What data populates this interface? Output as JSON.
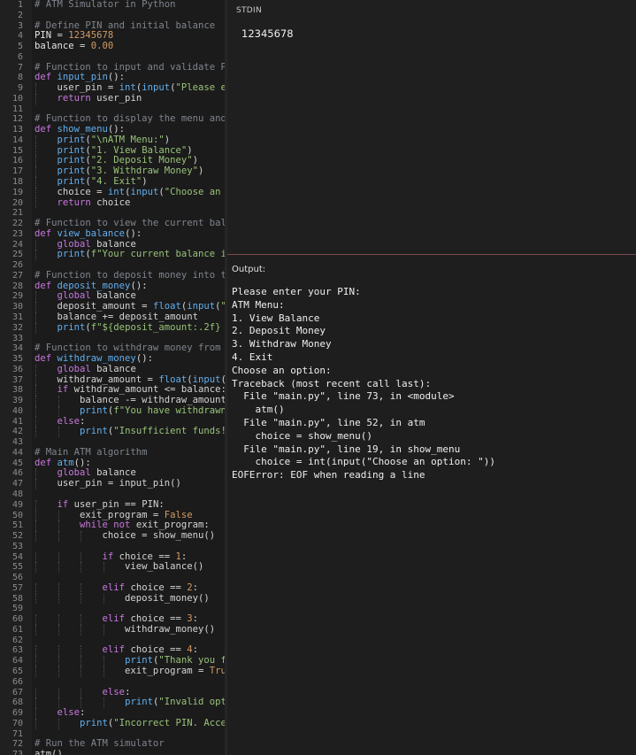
{
  "stdin": {
    "label": "STDIN",
    "value": "12345678"
  },
  "output": {
    "label": "Output:",
    "lines": [
      "Please enter your PIN:",
      "ATM Menu:",
      "1. View Balance",
      "2. Deposit Money",
      "3. Withdraw Money",
      "4. Exit",
      "Choose an option:",
      "Traceback (most recent call last):",
      "  File \"main.py\", line 73, in <module>",
      "    atm()",
      "  File \"main.py\", line 52, in atm",
      "    choice = show_menu()",
      "  File \"main.py\", line 19, in show_menu",
      "    choice = int(input(\"Choose an option: \"))",
      "EOFError: EOF when reading a line"
    ]
  },
  "editor": {
    "lines": [
      [
        [
          "c",
          "# ATM Simulator in Python"
        ]
      ],
      [],
      [
        [
          "c",
          "# Define PIN and initial balance"
        ]
      ],
      [
        [
          "v",
          "PIN "
        ],
        [
          "o",
          "= "
        ],
        [
          "n",
          "12345678"
        ]
      ],
      [
        [
          "v",
          "balance "
        ],
        [
          "o",
          "= "
        ],
        [
          "n",
          "0.00"
        ]
      ],
      [],
      [
        [
          "c",
          "# Function to input and validate PI"
        ]
      ],
      [
        [
          "k",
          "def "
        ],
        [
          "f",
          "input_pin"
        ],
        [
          "o",
          "():"
        ]
      ],
      [
        [
          "o",
          "    user_pin = "
        ],
        [
          "f",
          "int"
        ],
        [
          "o",
          "("
        ],
        [
          "f",
          "input"
        ],
        [
          "o",
          "("
        ],
        [
          "s",
          "\"Please en"
        ]
      ],
      [
        [
          "k",
          "    return "
        ],
        [
          "o",
          "user_pin"
        ]
      ],
      [],
      [
        [
          "c",
          "# Function to display the menu and"
        ]
      ],
      [
        [
          "k",
          "def "
        ],
        [
          "f",
          "show_menu"
        ],
        [
          "o",
          "():"
        ]
      ],
      [
        [
          "o",
          "    "
        ],
        [
          "f",
          "print"
        ],
        [
          "o",
          "("
        ],
        [
          "s",
          "\"\\nATM Menu:\""
        ],
        [
          "o",
          ")"
        ]
      ],
      [
        [
          "o",
          "    "
        ],
        [
          "f",
          "print"
        ],
        [
          "o",
          "("
        ],
        [
          "s",
          "\"1. View Balance\""
        ],
        [
          "o",
          ")"
        ]
      ],
      [
        [
          "o",
          "    "
        ],
        [
          "f",
          "print"
        ],
        [
          "o",
          "("
        ],
        [
          "s",
          "\"2. Deposit Money\""
        ],
        [
          "o",
          ")"
        ]
      ],
      [
        [
          "o",
          "    "
        ],
        [
          "f",
          "print"
        ],
        [
          "o",
          "("
        ],
        [
          "s",
          "\"3. Withdraw Money\""
        ],
        [
          "o",
          ")"
        ]
      ],
      [
        [
          "o",
          "    "
        ],
        [
          "f",
          "print"
        ],
        [
          "o",
          "("
        ],
        [
          "s",
          "\"4. Exit\""
        ],
        [
          "o",
          ")"
        ]
      ],
      [
        [
          "o",
          "    choice = "
        ],
        [
          "f",
          "int"
        ],
        [
          "o",
          "("
        ],
        [
          "f",
          "input"
        ],
        [
          "o",
          "("
        ],
        [
          "s",
          "\"Choose an o"
        ]
      ],
      [
        [
          "k",
          "    return "
        ],
        [
          "o",
          "choice"
        ]
      ],
      [],
      [
        [
          "c",
          "# Function to view the current bala"
        ]
      ],
      [
        [
          "k",
          "def "
        ],
        [
          "f",
          "view_balance"
        ],
        [
          "o",
          "():"
        ]
      ],
      [
        [
          "k",
          "    global "
        ],
        [
          "o",
          "balance"
        ]
      ],
      [
        [
          "o",
          "    "
        ],
        [
          "f",
          "print"
        ],
        [
          "o",
          "("
        ],
        [
          "s",
          "f\"Your current balance is"
        ]
      ],
      [],
      [
        [
          "c",
          "# Function to deposit money into th"
        ]
      ],
      [
        [
          "k",
          "def "
        ],
        [
          "f",
          "deposit_money"
        ],
        [
          "o",
          "():"
        ]
      ],
      [
        [
          "k",
          "    global "
        ],
        [
          "o",
          "balance"
        ]
      ],
      [
        [
          "o",
          "    deposit_amount = "
        ],
        [
          "f",
          "float"
        ],
        [
          "o",
          "("
        ],
        [
          "f",
          "input"
        ],
        [
          "o",
          "("
        ],
        [
          "s",
          "\"E"
        ]
      ],
      [
        [
          "o",
          "    balance += deposit_amount"
        ]
      ],
      [
        [
          "o",
          "    "
        ],
        [
          "f",
          "print"
        ],
        [
          "o",
          "("
        ],
        [
          "s",
          "f\"${deposit_amount:.2f} h"
        ]
      ],
      [],
      [
        [
          "c",
          "# Function to withdraw money from t"
        ]
      ],
      [
        [
          "k",
          "def "
        ],
        [
          "f",
          "withdraw_money"
        ],
        [
          "o",
          "():"
        ]
      ],
      [
        [
          "k",
          "    global "
        ],
        [
          "o",
          "balance"
        ]
      ],
      [
        [
          "o",
          "    withdraw_amount = "
        ],
        [
          "f",
          "float"
        ],
        [
          "o",
          "("
        ],
        [
          "f",
          "input"
        ],
        [
          "o",
          "("
        ],
        [
          "s",
          "'"
        ]
      ],
      [
        [
          "k",
          "    if "
        ],
        [
          "o",
          "withdraw_amount <= balance:"
        ]
      ],
      [
        [
          "o",
          "        balance -= withdraw_amount"
        ]
      ],
      [
        [
          "o",
          "        "
        ],
        [
          "f",
          "print"
        ],
        [
          "o",
          "("
        ],
        [
          "s",
          "f\"You have withdrawn"
        ]
      ],
      [
        [
          "k",
          "    else"
        ],
        [
          "o",
          ":"
        ]
      ],
      [
        [
          "o",
          "        "
        ],
        [
          "f",
          "print"
        ],
        [
          "o",
          "("
        ],
        [
          "s",
          "\"Insufficient funds!"
        ]
      ],
      [],
      [
        [
          "c",
          "# Main ATM algorithm"
        ]
      ],
      [
        [
          "k",
          "def "
        ],
        [
          "f",
          "atm"
        ],
        [
          "o",
          "():"
        ]
      ],
      [
        [
          "k",
          "    global "
        ],
        [
          "o",
          "balance"
        ]
      ],
      [
        [
          "o",
          "    user_pin = input_pin()"
        ]
      ],
      [],
      [
        [
          "k",
          "    if "
        ],
        [
          "o",
          "user_pin == PIN:"
        ]
      ],
      [
        [
          "o",
          "        exit_program = "
        ],
        [
          "n",
          "False"
        ]
      ],
      [
        [
          "k",
          "        while not "
        ],
        [
          "o",
          "exit_program:"
        ]
      ],
      [
        [
          "o",
          "            choice = show_menu()"
        ]
      ],
      [],
      [
        [
          "k",
          "            if "
        ],
        [
          "o",
          "choice == "
        ],
        [
          "n",
          "1"
        ],
        [
          "o",
          ":"
        ]
      ],
      [
        [
          "o",
          "                view_balance()"
        ]
      ],
      [],
      [
        [
          "k",
          "            elif "
        ],
        [
          "o",
          "choice == "
        ],
        [
          "n",
          "2"
        ],
        [
          "o",
          ":"
        ]
      ],
      [
        [
          "o",
          "                deposit_money()"
        ]
      ],
      [],
      [
        [
          "k",
          "            elif "
        ],
        [
          "o",
          "choice == "
        ],
        [
          "n",
          "3"
        ],
        [
          "o",
          ":"
        ]
      ],
      [
        [
          "o",
          "                withdraw_money()"
        ]
      ],
      [],
      [
        [
          "k",
          "            elif "
        ],
        [
          "o",
          "choice == "
        ],
        [
          "n",
          "4"
        ],
        [
          "o",
          ":"
        ]
      ],
      [
        [
          "o",
          "                "
        ],
        [
          "f",
          "print"
        ],
        [
          "o",
          "("
        ],
        [
          "s",
          "\"Thank you fo"
        ]
      ],
      [
        [
          "o",
          "                exit_program = "
        ],
        [
          "n",
          "True"
        ]
      ],
      [],
      [
        [
          "k",
          "            else"
        ],
        [
          "o",
          ":"
        ]
      ],
      [
        [
          "o",
          "                "
        ],
        [
          "f",
          "print"
        ],
        [
          "o",
          "("
        ],
        [
          "s",
          "\"Invalid opti"
        ]
      ],
      [
        [
          "k",
          "    else"
        ],
        [
          "o",
          ":"
        ]
      ],
      [
        [
          "o",
          "        "
        ],
        [
          "f",
          "print"
        ],
        [
          "o",
          "("
        ],
        [
          "s",
          "\"Incorrect PIN. Acces"
        ]
      ],
      [],
      [
        [
          "c",
          "# Run the ATM simulator"
        ]
      ],
      [
        [
          "o",
          "atm()"
        ]
      ]
    ]
  }
}
